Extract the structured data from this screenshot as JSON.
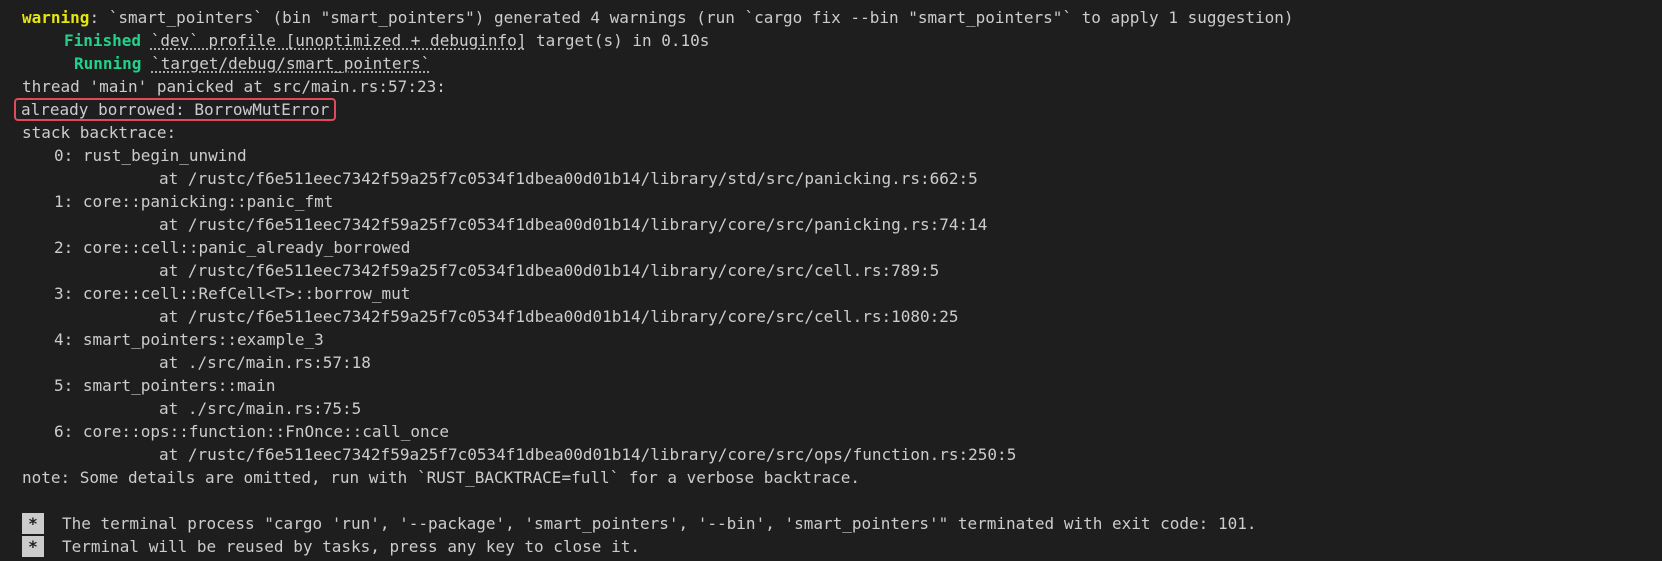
{
  "colors": {
    "background": "#1e1e1e",
    "text": "#cccccc",
    "warning": "#e5e510",
    "success": "#23d18b",
    "highlight_border": "#e04a5a"
  },
  "header": {
    "warning_label": "warning",
    "warning_text": ": `smart_pointers` (bin \"smart_pointers\") generated 4 warnings (run `cargo fix --bin \"smart_pointers\"` to apply 1 suggestion)",
    "finished_label": "Finished",
    "finished_profile": "`dev` profile [unoptimized + debuginfo]",
    "finished_rest": " target(s) in 0.10s",
    "running_label": "Running",
    "running_path": "`target/debug/smart_pointers`",
    "panic_line": "thread 'main' panicked at src/main.rs:57:23:",
    "error_message": "already borrowed: BorrowMutError",
    "backtrace_label": "stack backtrace:"
  },
  "backtrace": [
    {
      "frame": "0: rust_begin_unwind",
      "location": "at /rustc/f6e511eec7342f59a25f7c0534f1dbea00d01b14/library/std/src/panicking.rs:662:5"
    },
    {
      "frame": "1: core::panicking::panic_fmt",
      "location": "at /rustc/f6e511eec7342f59a25f7c0534f1dbea00d01b14/library/core/src/panicking.rs:74:14"
    },
    {
      "frame": "2: core::cell::panic_already_borrowed",
      "location": "at /rustc/f6e511eec7342f59a25f7c0534f1dbea00d01b14/library/core/src/cell.rs:789:5"
    },
    {
      "frame": "3: core::cell::RefCell<T>::borrow_mut",
      "location": "at /rustc/f6e511eec7342f59a25f7c0534f1dbea00d01b14/library/core/src/cell.rs:1080:25"
    },
    {
      "frame": "4: smart_pointers::example_3",
      "location": "at ./src/main.rs:57:18"
    },
    {
      "frame": "5: smart_pointers::main",
      "location": "at ./src/main.rs:75:5"
    },
    {
      "frame": "6: core::ops::function::FnOnce::call_once",
      "location": "at /rustc/f6e511eec7342f59a25f7c0534f1dbea00d01b14/library/core/src/ops/function.rs:250:5"
    }
  ],
  "note": "note: Some details are omitted, run with `RUST_BACKTRACE=full` for a verbose backtrace.",
  "task": {
    "star": "*",
    "terminated": "The terminal process \"cargo 'run', '--package', 'smart_pointers', '--bin', 'smart_pointers'\" terminated with exit code: 101.",
    "reuse": "Terminal will be reused by tasks, press any key to close it."
  }
}
